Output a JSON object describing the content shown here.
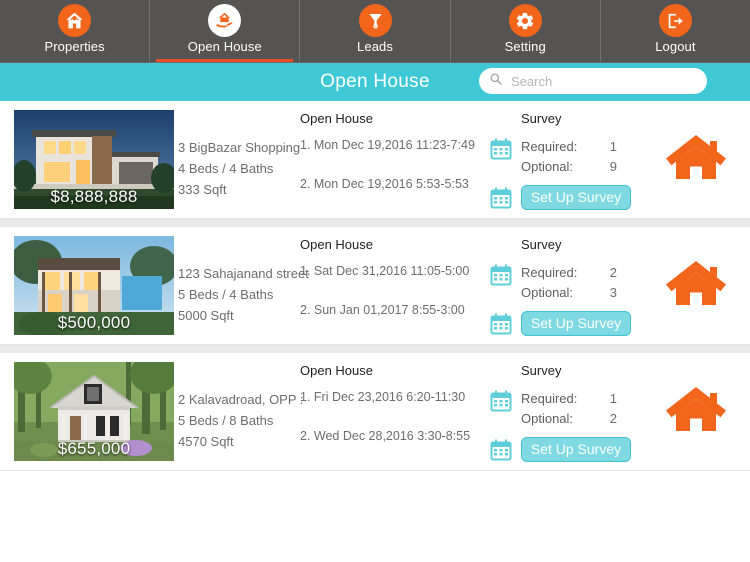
{
  "tabs": [
    {
      "label": "Properties",
      "icon": "house-icon",
      "active": false
    },
    {
      "label": "Open House",
      "icon": "house-on-hand-icon",
      "active": true
    },
    {
      "label": "Leads",
      "icon": "funnel-icon",
      "active": false
    },
    {
      "label": "Setting",
      "icon": "gear-icon",
      "active": false
    },
    {
      "label": "Logout",
      "icon": "logout-icon",
      "active": false
    }
  ],
  "header": {
    "title": "Open House",
    "search_placeholder": "Search",
    "search_value": "",
    "search_icon": "search-icon"
  },
  "labels": {
    "open_house": "Open House",
    "survey": "Survey",
    "required": "Required:",
    "optional": "Optional:",
    "setup_survey": "Set Up Survey",
    "calendar_icon": "calendar-icon",
    "house_icon": "house-icon"
  },
  "colors": {
    "tabbar_bg": "#565353",
    "accent_orange": "#F4651C",
    "active_underline": "#E8502A",
    "header_teal": "#3FC9D6",
    "button_teal": "#7FD9E2",
    "list_bg": "#E9E9E9"
  },
  "listings": [
    {
      "price": "$8,888,888",
      "address": "3 BigBazar Shopping",
      "beds_baths": "4 Beds / 4 Baths",
      "area": "333 Sqft",
      "open_house_1": "1. Mon Dec 19,2016 11:23-7:49",
      "open_house_2": "2. Mon Dec 19,2016 5:53-5:53",
      "required": "1",
      "optional": "9",
      "thumb": "modern-house-night"
    },
    {
      "price": "$500,000",
      "address": "123 Sahajanand street",
      "beds_baths": "5 Beds / 4 Baths",
      "area": "5000 Sqft",
      "open_house_1": "1. Sat Dec 31,2016 11:05-5:00",
      "open_house_2": "2. Sun Jan 01,2017 8:55-3:00",
      "required": "2",
      "optional": "3",
      "thumb": "hillside-house-dusk"
    },
    {
      "price": "$655,000",
      "address": "2 Kalavadroad, OPP :",
      "beds_baths": "5 Beds / 8 Baths",
      "area": "4570 Sqft",
      "open_house_1": "1. Fri Dec 23,2016 6:20-11:30",
      "open_house_2": "2. Wed Dec 28,2016 3:30-8:55",
      "required": "1",
      "optional": "2",
      "thumb": "white-cottage-forest"
    }
  ]
}
